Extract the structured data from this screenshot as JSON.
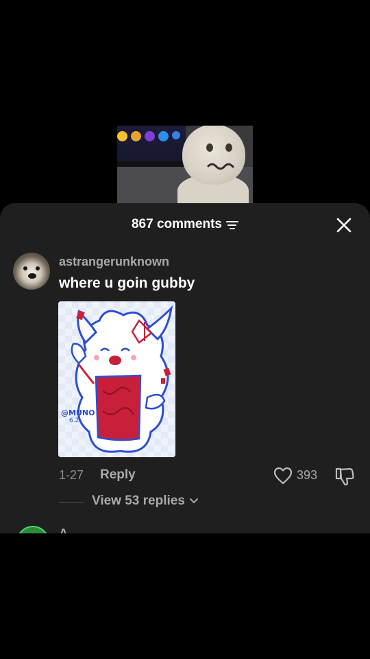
{
  "sheet": {
    "comment_count": "867 comments",
    "filter_icon": "filter-icon",
    "close_icon": "close-icon"
  },
  "comment": {
    "username": "astrangerunknown",
    "text": "where u goin gubby",
    "date": "1-27",
    "reply_label": "Reply",
    "likes": "393",
    "view_replies": "View 53 replies",
    "image_watermark": "@MUNO",
    "image_watermark_sub": "6.2"
  },
  "next_comment": {
    "username": "A"
  },
  "colors": {
    "sheet_bg": "#1f1f1f",
    "muted_text": "#a9a9ab",
    "accent_red": "#c8203a"
  }
}
